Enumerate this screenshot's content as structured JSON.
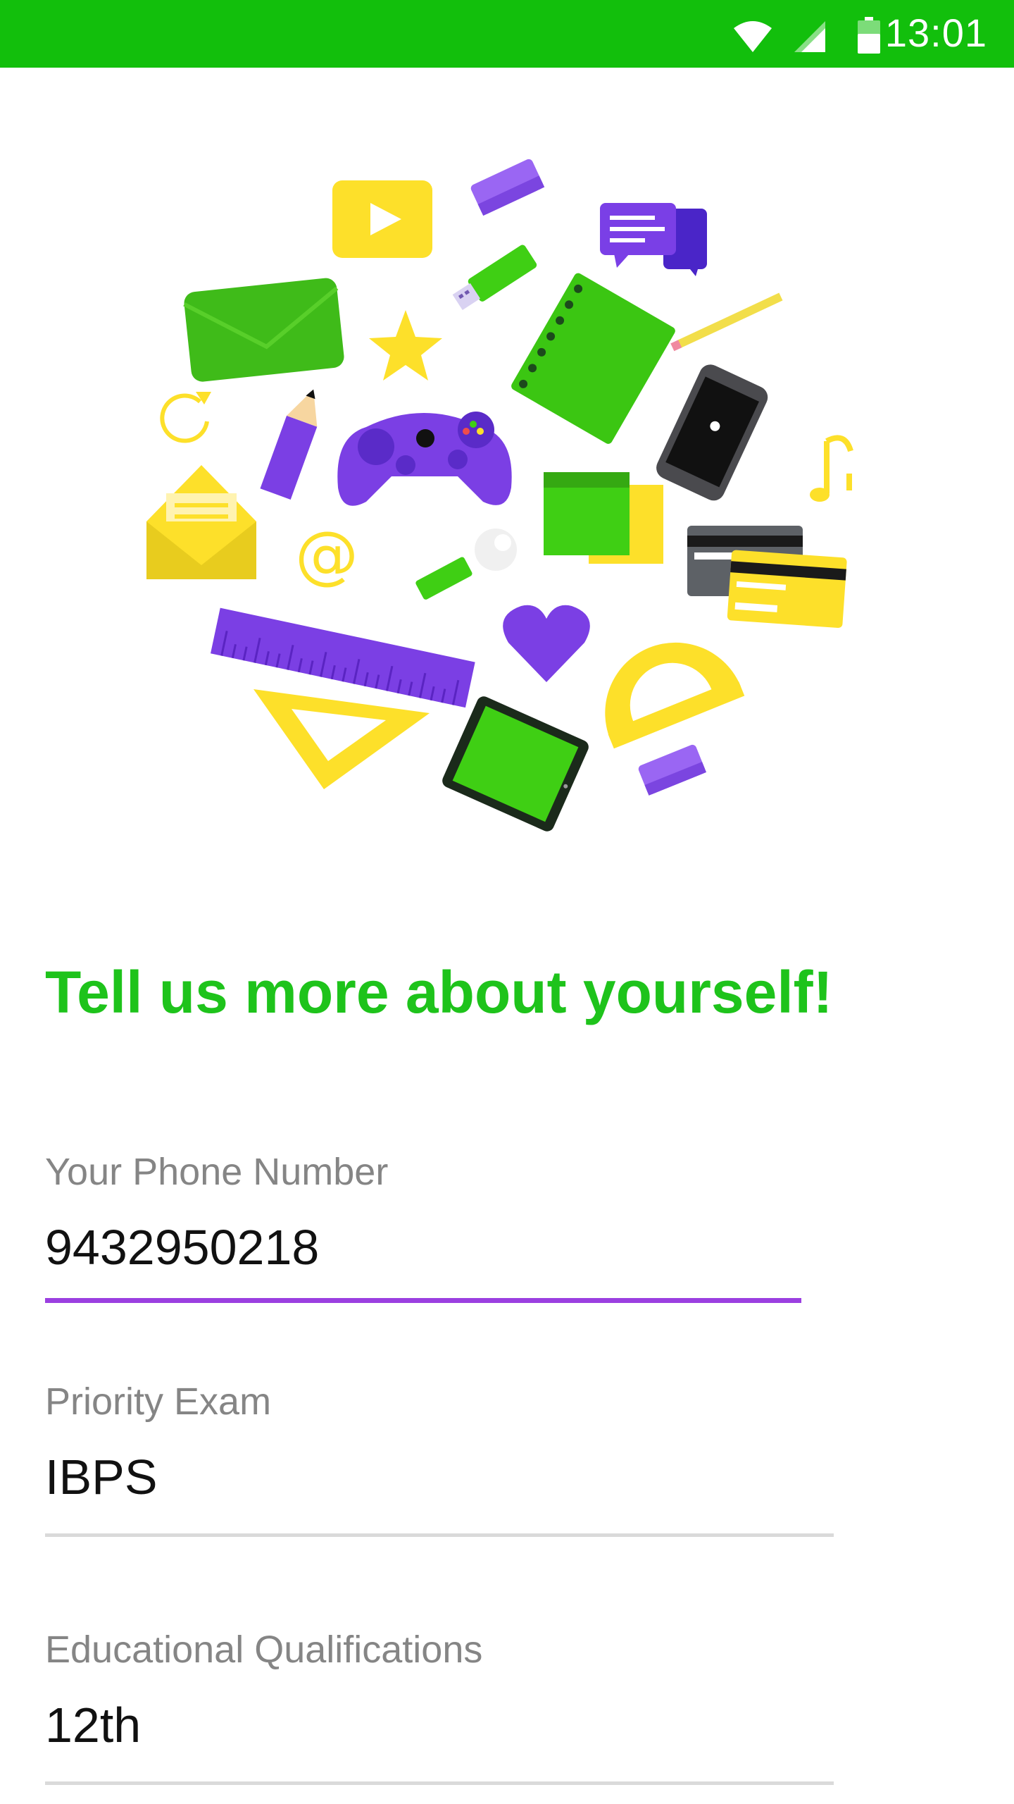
{
  "status_bar": {
    "time": "13:01",
    "icons": [
      "wifi-icon",
      "signal-icon",
      "battery-icon"
    ],
    "background": "#12bf0c"
  },
  "heading": "Tell us more about yourself!",
  "form": {
    "phone": {
      "label": "Your Phone Number",
      "value": "9432950218",
      "focused": true
    },
    "exam": {
      "label": "Priority Exam",
      "value": "IBPS"
    },
    "qualification": {
      "label": "Educational Qualifications",
      "value": "12th"
    }
  },
  "colors": {
    "accent_green": "#1ec31b",
    "focus_purple": "#9b3fe0",
    "line_gray": "#dadada",
    "purple": "#7b3fe4",
    "yellow": "#fde02a"
  },
  "illustration_icons": [
    "play-icon",
    "eraser-icon",
    "chat-icon",
    "envelope-icon",
    "usb-drive-icon",
    "star-icon",
    "notebook-icon",
    "pencil-icon",
    "refresh-icon",
    "game-controller-icon",
    "smartphone-icon",
    "music-note-icon",
    "open-envelope-icon",
    "at-sign-icon",
    "sticky-notes-icon",
    "wrench-icon",
    "credit-card-icon",
    "ruler-icon",
    "heart-icon",
    "protractor-icon",
    "set-square-icon",
    "tablet-icon"
  ]
}
